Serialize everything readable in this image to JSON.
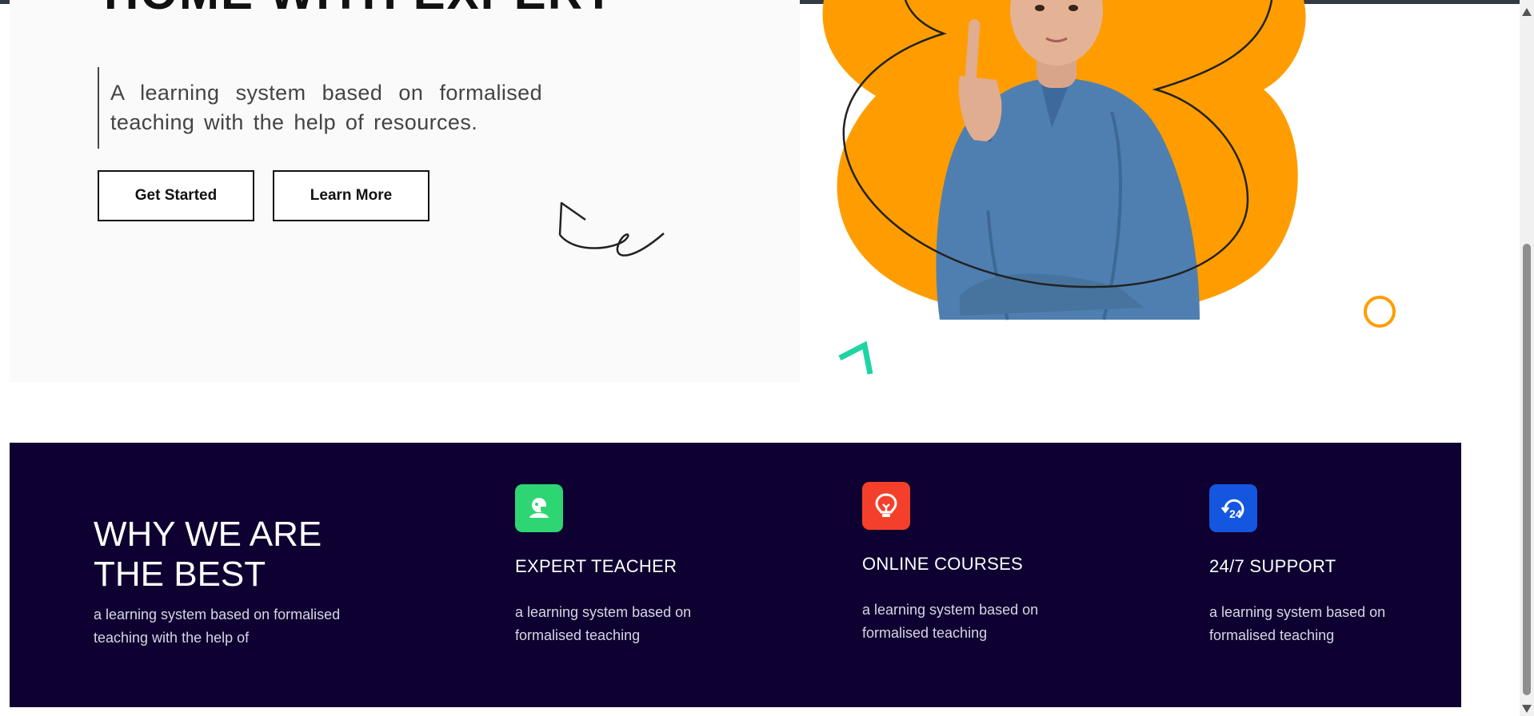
{
  "hero": {
    "title_fragment": "HOME WITH EXPERT",
    "description": "A learning system based on formalised teaching with the help of resources.",
    "buttons": {
      "get_started": "Get Started",
      "learn_more": "Learn More"
    }
  },
  "why": {
    "title_line1": "WHY WE ARE",
    "title_line2": "THE BEST",
    "text": "a learning system based on formalised teaching with the help of"
  },
  "features": [
    {
      "title": "EXPERT TEACHER",
      "text": "a learning system based on formalised teaching",
      "icon": "teacher-icon",
      "color": "#2ed573"
    },
    {
      "title": "ONLINE COURSES",
      "text": "a learning system based on formalised teaching",
      "icon": "bulb-icon",
      "color": "#f4402a"
    },
    {
      "title": "24/7 SUPPORT",
      "text": "a learning system based on formalised teaching",
      "icon": "support-24-icon",
      "color": "#1456e0"
    }
  ],
  "colors": {
    "accent_orange": "#ff9d00",
    "accent_teal": "#1ed3a4",
    "features_background": "#0e0030",
    "hero_panel": "#fafafa"
  }
}
